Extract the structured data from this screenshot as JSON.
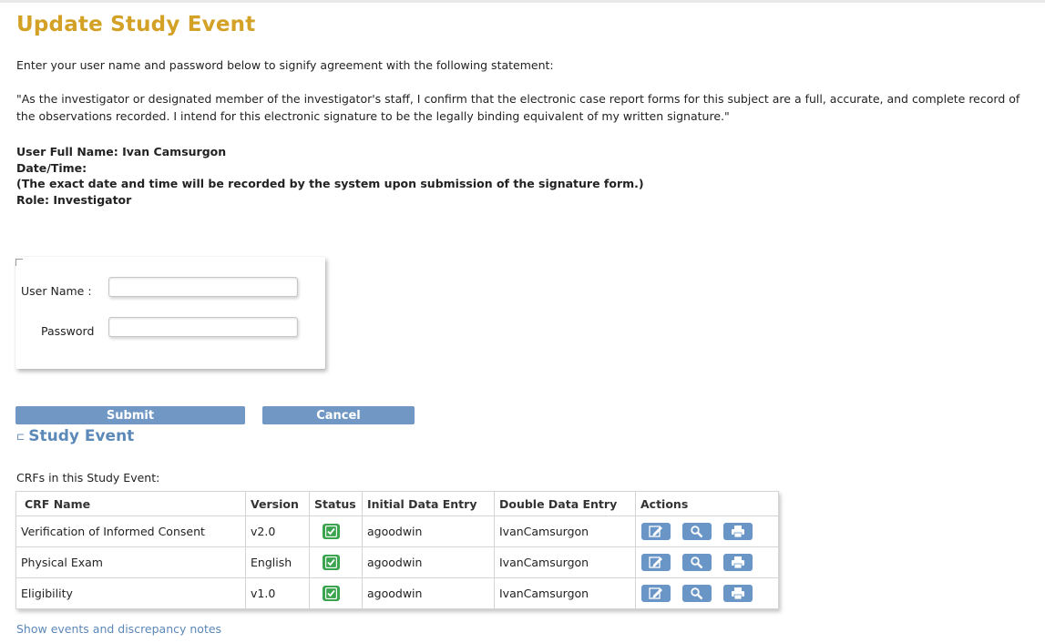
{
  "page": {
    "title": "Update Study Event",
    "instruction": "Enter your user name and password below to signify agreement with the following statement:",
    "statement": "\"As the investigator or designated member of the investigator's staff, I confirm that the electronic case report forms for this subject are a full, accurate, and complete record of the observations recorded. I intend for this electronic signature to be the legally binding equivalent of my written signature.\""
  },
  "info": {
    "user_full_name": "User Full Name: Ivan Camsurgon",
    "date_time": "Date/Time:",
    "note": "(The exact date and time will be recorded by the system upon submission of the signature form.)",
    "role": "Role: Investigator"
  },
  "login": {
    "user_label": "User Name :",
    "user_value": "",
    "password_label": "Password",
    "password_value": ""
  },
  "buttons": {
    "submit": "Submit",
    "cancel": "Cancel"
  },
  "study_event": {
    "section_title": "Study Event",
    "crfs_label": "CRFs in this Study Event:",
    "headers": [
      "CRF Name",
      "Version",
      "Status",
      "Initial Data Entry",
      "Double Data Entry",
      "Actions"
    ],
    "rows": [
      {
        "crf_name": "Verification of Informed Consent",
        "version": "v2.0",
        "status": "completed",
        "initial": "agoodwin",
        "double": "IvanCamsurgon"
      },
      {
        "crf_name": "Physical Exam",
        "version": "English",
        "status": "completed",
        "initial": "agoodwin",
        "double": "IvanCamsurgon"
      },
      {
        "crf_name": "Eligibility",
        "version": "v1.0",
        "status": "completed",
        "initial": "agoodwin",
        "double": "IvanCamsurgon"
      }
    ],
    "action_icons": [
      "edit-icon",
      "view-icon",
      "print-icon"
    ]
  },
  "footer": {
    "link": "Show events and discrepancy notes"
  },
  "colors": {
    "title": "#d4a127",
    "accent": "#5b89b8",
    "button": "#7198c4",
    "status_green": "#3aa44e"
  }
}
